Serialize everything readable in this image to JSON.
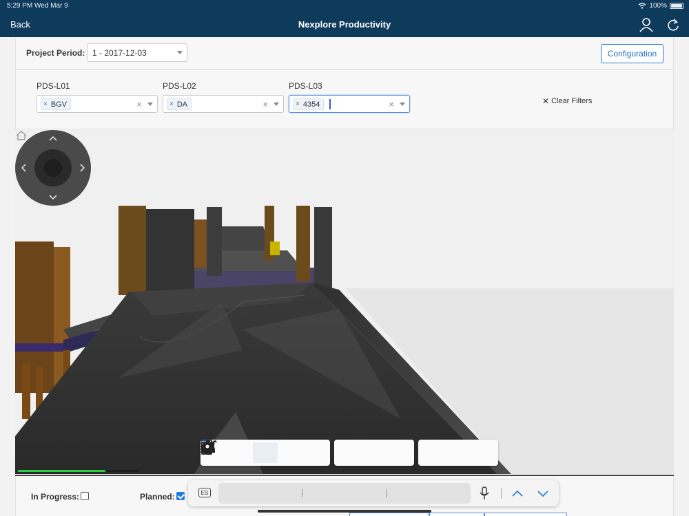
{
  "status_bar": {
    "time": "5:29 PM  Wed Mar 9",
    "battery": "100%"
  },
  "nav": {
    "back_label": "Back",
    "title": "Nexplore Productivity",
    "icons": [
      "user-icon",
      "refresh-icon"
    ]
  },
  "period": {
    "label": "Project Period:",
    "value": "1 - 2017-12-03",
    "config_label": "Configuration"
  },
  "filters": [
    {
      "label": "PDS-L01",
      "tag": "BGV",
      "active": false
    },
    {
      "label": "PDS-L02",
      "tag": "DA",
      "active": false
    },
    {
      "label": "PDS-L03",
      "tag": "4354",
      "active": true
    }
  ],
  "clear_filters_label": "Clear Filters",
  "viewer": {
    "tools_group1": [
      "orbit-icon",
      "pan-icon",
      "first-person-icon",
      "camera-icon",
      "zoom-window-icon"
    ],
    "tools_group2": [
      "measure-icon",
      "section-icon",
      "explode-icon"
    ],
    "tools_group3": [
      "model-tree-icon",
      "properties-icon",
      "settings-icon"
    ],
    "active_tool": "first-person-icon",
    "load_progress": 0.72
  },
  "bottom": {
    "in_progress_label": "In Progress:",
    "in_progress_checked": false,
    "planned_label": "Planned:",
    "planned_checked": true
  },
  "keyboard_bar": {
    "lang": "ES"
  },
  "colors": {
    "nav_bg": "#0e3a5c",
    "accent": "#1f7ae0",
    "progress": "#2ecc40"
  }
}
